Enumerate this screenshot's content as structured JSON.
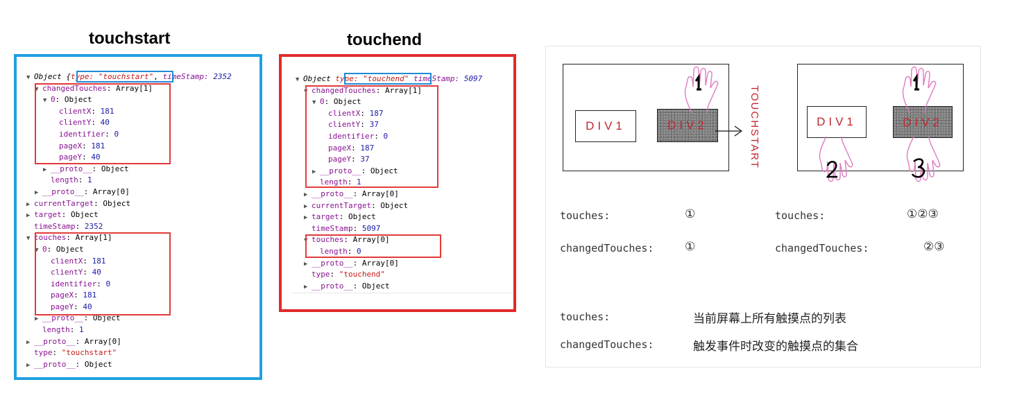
{
  "left": {
    "title": "touchstart",
    "lines": [
      {
        "t": "▼",
        "p": [
          [
            "Object ",
            "it"
          ],
          [
            "{",
            "it"
          ],
          [
            "type: \"touchstart\"",
            "it s"
          ],
          ", ",
          [
            "timeStamp: ",
            "it k"
          ],
          [
            "2352",
            "it n"
          ]
        ]
      },
      {
        "t": "▼",
        "p": [
          [
            "changedTouches",
            "k"
          ],
          ": Array[1]"
        ]
      },
      {
        "t": "▼",
        "p": [
          [
            "0",
            "k"
          ],
          ": Object"
        ]
      },
      {
        "t": "",
        "p": [
          [
            "clientX",
            "k"
          ],
          ": ",
          [
            "181",
            "n"
          ]
        ]
      },
      {
        "t": "",
        "p": [
          [
            "clientY",
            "k"
          ],
          ": ",
          [
            "40",
            "n"
          ]
        ]
      },
      {
        "t": "",
        "p": [
          [
            "identifier",
            "k"
          ],
          ": ",
          [
            "0",
            "n"
          ]
        ]
      },
      {
        "t": "",
        "p": [
          [
            "pageX",
            "k"
          ],
          ": ",
          [
            "181",
            "n"
          ]
        ]
      },
      {
        "t": "",
        "p": [
          [
            "pageY",
            "k"
          ],
          ": ",
          [
            "40",
            "n"
          ]
        ]
      },
      {
        "t": "▶",
        "p": [
          [
            "__proto__",
            "k"
          ],
          ": Object"
        ]
      },
      {
        "t": "",
        "p": [
          [
            "length",
            "k"
          ],
          ": ",
          [
            "1",
            "n"
          ]
        ]
      },
      {
        "t": "▶",
        "p": [
          [
            "__proto__",
            "k"
          ],
          ": Array[0]"
        ]
      },
      {
        "t": "▶",
        "p": [
          [
            "currentTarget",
            "k"
          ],
          ": Object"
        ]
      },
      {
        "t": "▶",
        "p": [
          [
            "target",
            "k"
          ],
          ": Object"
        ]
      },
      {
        "t": "",
        "p": [
          [
            "timeStamp",
            "k"
          ],
          ": ",
          [
            "2352",
            "n"
          ]
        ]
      },
      {
        "t": "▼",
        "p": [
          [
            "touches",
            "k"
          ],
          ": Array[1]"
        ]
      },
      {
        "t": "▼",
        "p": [
          [
            "0",
            "k"
          ],
          ": Object"
        ]
      },
      {
        "t": "",
        "p": [
          [
            "clientX",
            "k"
          ],
          ": ",
          [
            "181",
            "n"
          ]
        ]
      },
      {
        "t": "",
        "p": [
          [
            "clientY",
            "k"
          ],
          ": ",
          [
            "40",
            "n"
          ]
        ]
      },
      {
        "t": "",
        "p": [
          [
            "identifier",
            "k"
          ],
          ": ",
          [
            "0",
            "n"
          ]
        ]
      },
      {
        "t": "",
        "p": [
          [
            "pageX",
            "k"
          ],
          ": ",
          [
            "181",
            "n"
          ]
        ]
      },
      {
        "t": "",
        "p": [
          [
            "pageY",
            "k"
          ],
          ": ",
          [
            "40",
            "n"
          ]
        ]
      },
      {
        "t": "▶",
        "p": [
          [
            "__proto__",
            "k"
          ],
          ": Object"
        ]
      },
      {
        "t": "",
        "p": [
          [
            "length",
            "k"
          ],
          ": ",
          [
            "1",
            "n"
          ]
        ]
      },
      {
        "t": "▶",
        "p": [
          [
            "__proto__",
            "k"
          ],
          ": Array[0]"
        ]
      },
      {
        "t": "",
        "p": [
          [
            "type",
            "k"
          ],
          ": ",
          [
            "\"touchstart\"",
            "s"
          ]
        ]
      },
      {
        "t": "▶",
        "p": [
          [
            "__proto__",
            "k"
          ],
          ": Object"
        ]
      }
    ]
  },
  "middle": {
    "title": "touchend",
    "lines": [
      {
        "t": "▼",
        "p": [
          [
            "Object ",
            "it"
          ],
          [
            "type: \"touchend\"",
            "it s"
          ],
          "  ",
          [
            "timeStamp: ",
            "it k"
          ],
          [
            "5097",
            "it n"
          ]
        ]
      },
      {
        "t": "▼",
        "p": [
          [
            "changedTouches",
            "k"
          ],
          ": Array[1]"
        ]
      },
      {
        "t": "▼",
        "p": [
          [
            "0",
            "k"
          ],
          ": Object"
        ]
      },
      {
        "t": "",
        "p": [
          [
            "clientX",
            "k"
          ],
          ": ",
          [
            "187",
            "n"
          ]
        ]
      },
      {
        "t": "",
        "p": [
          [
            "clientY",
            "k"
          ],
          ": ",
          [
            "37",
            "n"
          ]
        ]
      },
      {
        "t": "",
        "p": [
          [
            "identifier",
            "k"
          ],
          ": ",
          [
            "0",
            "n"
          ]
        ]
      },
      {
        "t": "",
        "p": [
          [
            "pageX",
            "k"
          ],
          ": ",
          [
            "187",
            "n"
          ]
        ]
      },
      {
        "t": "",
        "p": [
          [
            "pageY",
            "k"
          ],
          ": ",
          [
            "37",
            "n"
          ]
        ]
      },
      {
        "t": "▶",
        "p": [
          [
            "__proto__",
            "k"
          ],
          ": Object"
        ]
      },
      {
        "t": "",
        "p": [
          [
            "length",
            "k"
          ],
          ": ",
          [
            "1",
            "n"
          ]
        ]
      },
      {
        "t": "▶",
        "p": [
          [
            "__proto__",
            "k"
          ],
          ": Array[0]"
        ]
      },
      {
        "t": "▶",
        "p": [
          [
            "currentTarget",
            "k"
          ],
          ": Object"
        ]
      },
      {
        "t": "▶",
        "p": [
          [
            "target",
            "k"
          ],
          ": Object"
        ]
      },
      {
        "t": "",
        "p": [
          [
            "timeStamp",
            "k"
          ],
          ": ",
          [
            "5097",
            "n"
          ]
        ]
      },
      {
        "t": "▼",
        "p": [
          [
            "touches",
            "k"
          ],
          ": Array[0]"
        ]
      },
      {
        "t": "",
        "p": [
          [
            "length",
            "k"
          ],
          ": ",
          [
            "0",
            "n"
          ]
        ]
      },
      {
        "t": "▶",
        "p": [
          [
            "__proto__",
            "k"
          ],
          ": Array[0]"
        ]
      },
      {
        "t": "",
        "p": [
          [
            "type",
            "k"
          ],
          ": ",
          [
            "\"touchend\"",
            "s"
          ]
        ]
      },
      {
        "t": "▶",
        "p": [
          [
            "__proto__",
            "k"
          ],
          ": Object"
        ]
      }
    ]
  },
  "diagram": {
    "div1": "DIV1",
    "div2": "DIV2",
    "event": "TOUCHSTART",
    "finger1": "1",
    "finger2": "2",
    "finger3": "3",
    "touches_label": "touches:",
    "changed_label": "changedTouches:",
    "before_touches": "①",
    "before_changed": "①",
    "after_touches": "①②③",
    "after_changed": "②③",
    "touches_desc": "当前屏幕上所有触摸点的列表",
    "changed_desc": "触发事件时改变的触摸点的集合",
    "colors": {
      "accent": "#c0262d",
      "finger": "#e07ac0"
    }
  }
}
